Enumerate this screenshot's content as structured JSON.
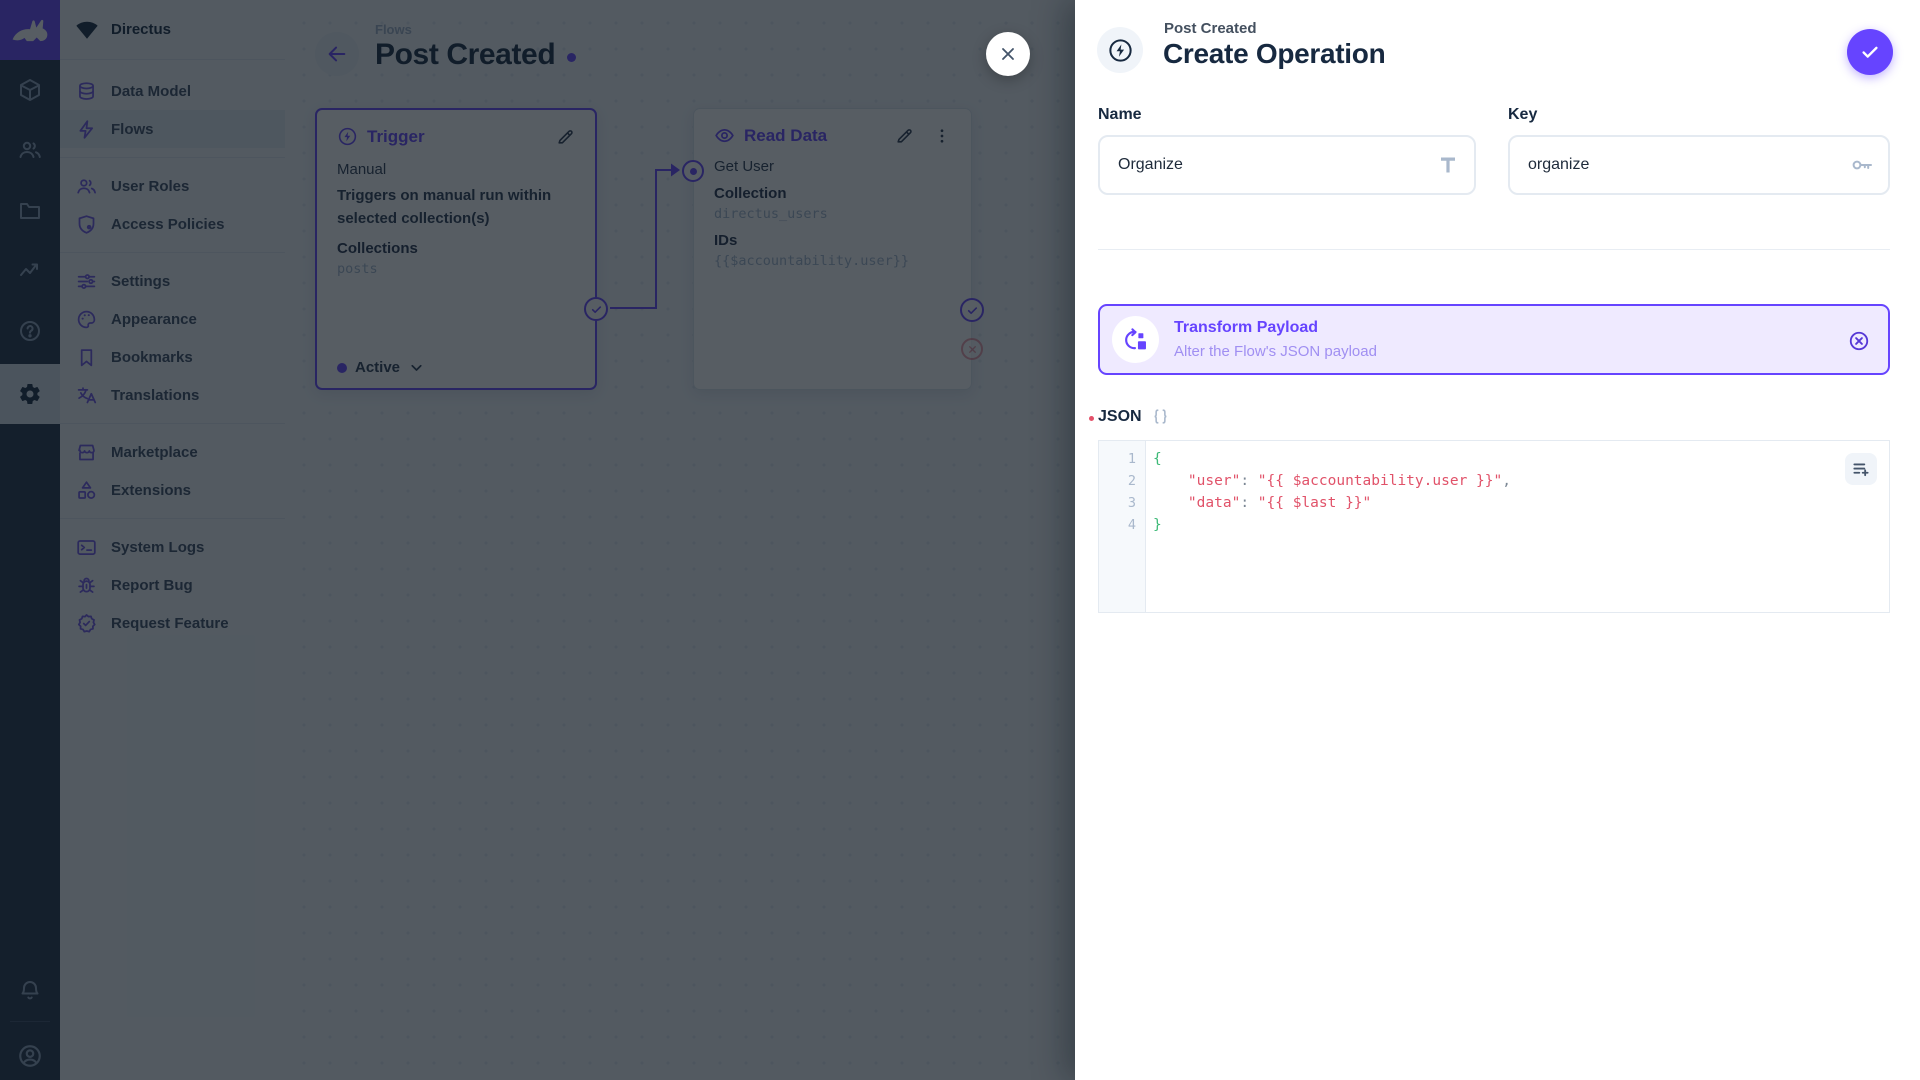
{
  "sidebar": {
    "project_name": "Directus",
    "groups": [
      {
        "items": [
          {
            "icon": "database",
            "label": "Data Model"
          },
          {
            "icon": "bolt",
            "label": "Flows",
            "active": true
          }
        ]
      },
      {
        "items": [
          {
            "icon": "people",
            "label": "User Roles"
          },
          {
            "icon": "shield",
            "label": "Access Policies"
          }
        ]
      },
      {
        "items": [
          {
            "icon": "tune",
            "label": "Settings"
          },
          {
            "icon": "palette",
            "label": "Appearance"
          },
          {
            "icon": "bookmark",
            "label": "Bookmarks"
          },
          {
            "icon": "translate",
            "label": "Translations"
          }
        ]
      },
      {
        "items": [
          {
            "icon": "storefront",
            "label": "Marketplace"
          },
          {
            "icon": "category",
            "label": "Extensions"
          }
        ]
      },
      {
        "items": [
          {
            "icon": "terminal",
            "label": "System Logs"
          },
          {
            "icon": "bug",
            "label": "Report Bug"
          },
          {
            "icon": "verified",
            "label": "Request Feature"
          }
        ]
      }
    ]
  },
  "module_bar": {
    "items": [
      {
        "icon": "cube",
        "name": "content"
      },
      {
        "icon": "people",
        "name": "users"
      },
      {
        "icon": "folder",
        "name": "files"
      },
      {
        "icon": "activity",
        "name": "insights"
      },
      {
        "icon": "help",
        "name": "docs"
      },
      {
        "icon": "gear",
        "name": "settings",
        "active": true
      }
    ]
  },
  "canvas": {
    "breadcrumb": "Flows",
    "title": "Post Created",
    "trigger_card": {
      "title": "Trigger",
      "type": "Manual",
      "description": "Triggers on manual run within selected collection(s)",
      "field_label": "Collections",
      "field_value": "posts",
      "status": "Active"
    },
    "operation_card": {
      "title": "Read Data",
      "name": "Get User",
      "fields": [
        {
          "label": "Collection",
          "value": "directus_users"
        },
        {
          "label": "IDs",
          "value": "{{$accountability.user}}"
        }
      ]
    }
  },
  "drawer": {
    "breadcrumb": "Post Created",
    "title": "Create Operation",
    "fields": {
      "name_label": "Name",
      "name_value": "Organize",
      "key_label": "Key",
      "key_value": "organize"
    },
    "operation_type": {
      "title": "Transform Payload",
      "subtitle": "Alter the Flow's JSON payload"
    },
    "json_label": "JSON",
    "code": {
      "lines": [
        {
          "num": "1",
          "segments": [
            {
              "t": "{",
              "c": "brace"
            }
          ]
        },
        {
          "num": "2",
          "segments": [
            {
              "t": "    ",
              "c": "plain"
            },
            {
              "t": "\"user\"",
              "c": "string"
            },
            {
              "t": ": ",
              "c": "plain"
            },
            {
              "t": "\"{{ $accountability.user }}\"",
              "c": "string"
            },
            {
              "t": ",",
              "c": "plain"
            }
          ]
        },
        {
          "num": "3",
          "segments": [
            {
              "t": "    ",
              "c": "plain"
            },
            {
              "t": "\"data\"",
              "c": "string"
            },
            {
              "t": ": ",
              "c": "plain"
            },
            {
              "t": "\"{{ $last }}\"",
              "c": "string"
            }
          ]
        },
        {
          "num": "4",
          "segments": [
            {
              "t": "}",
              "c": "brace"
            }
          ]
        }
      ]
    }
  },
  "colors": {
    "accent": "#6644FF",
    "danger": "#E35169",
    "green": "#3EBA78"
  }
}
